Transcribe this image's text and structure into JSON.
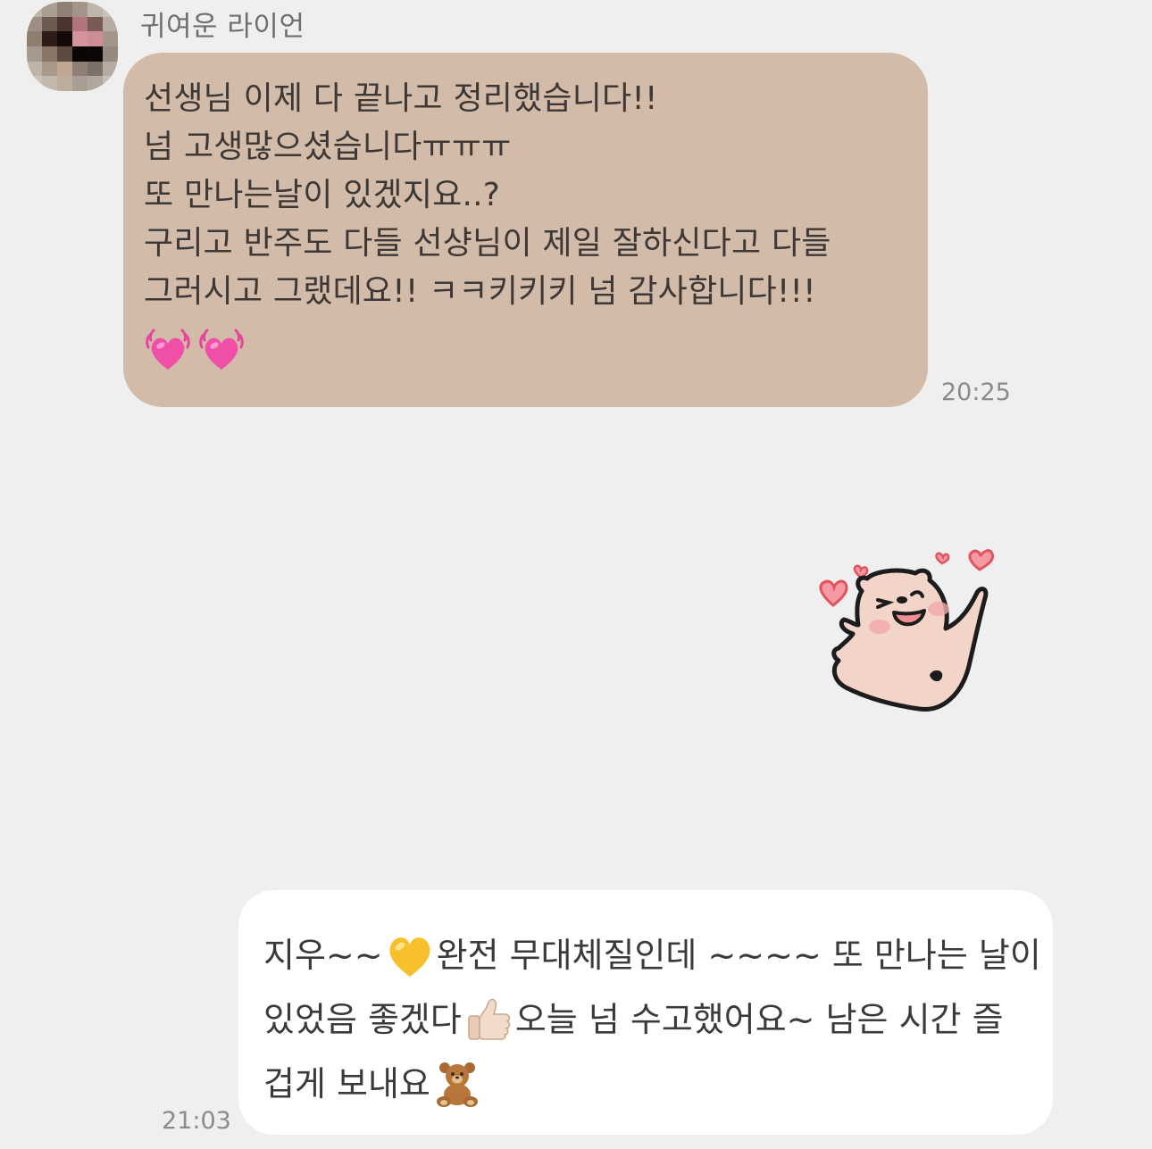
{
  "incoming": {
    "sender_name": "귀여운 라이언",
    "avatar": "pixelated-profile-photo",
    "lines": [
      "선생님 이제 다 끝나고 정리했습니다!!",
      "넘 고생많으셨습니다ㅠㅠㅠ",
      "또 만나는날이 있겠지요..?",
      "구리고 반주도 다들 선샹님이 제일 잘하신다고 다들",
      "그러시고 그랬데요!! ㅋㅋ키키키 넘 감사합니다!!!"
    ],
    "emojis": [
      "beating-heart-emoji",
      "beating-heart-emoji"
    ],
    "time": "20:25",
    "bubble_color": "#d3bba9"
  },
  "sticker": {
    "name": "happy-bear-with-hearts-sticker"
  },
  "outgoing": {
    "line1_a": "지우~~",
    "line1_emoji": "yellow-heart-emoji",
    "line1_b": "완전 무대체질인데 ~~~~ 또 만나는 날이",
    "line2_a": "있었음 좋겠다",
    "line2_emoji": "thumbs-up-emoji",
    "line2_b": " 오늘 넘 수고했어요~ 남은 시간 즐",
    "line3_a": "겁게 보내요",
    "line3_emoji": "teddy-bear-emoji",
    "time": "21:03",
    "bubble_color": "#ffffff"
  },
  "colors": {
    "background": "#efefef",
    "time_text": "#8b8b8b",
    "name_text": "#6f6f6f"
  }
}
